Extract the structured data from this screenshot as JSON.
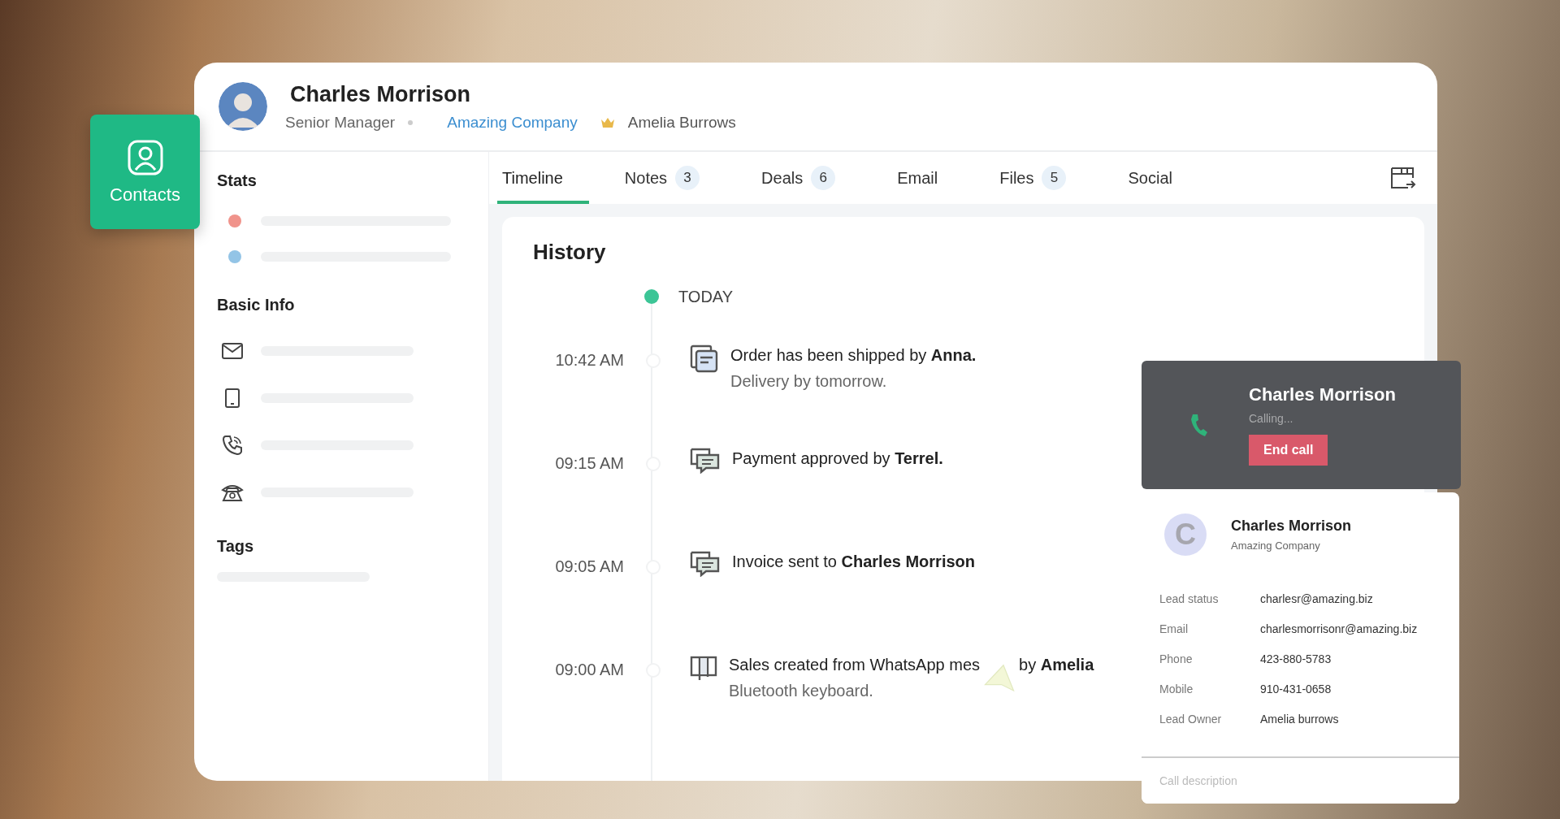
{
  "launcher": {
    "label": "Contacts"
  },
  "contact": {
    "name": "Charles Morrison",
    "title": "Senior Manager",
    "company": "Amazing Company",
    "owner": "Amelia Burrows"
  },
  "sidebar": {
    "sections": [
      {
        "kind": "stats",
        "heading": "Stats",
        "items": [
          {
            "color": "#f0938b"
          },
          {
            "color": "#93c4e6"
          }
        ]
      },
      {
        "kind": "info",
        "heading": "Basic Info"
      },
      {
        "kind": "tags",
        "heading": "Tags"
      }
    ]
  },
  "tabs": [
    {
      "label": "Timeline",
      "selected": true
    },
    {
      "label": "Notes",
      "count": "3",
      "selected": false
    },
    {
      "label": "Deals",
      "count": "6",
      "selected": false
    },
    {
      "label": "Email",
      "selected": false
    },
    {
      "label": "Files",
      "count": "5",
      "selected": false
    },
    {
      "label": "Social",
      "selected": false
    }
  ],
  "history": {
    "title": "History",
    "day": "TODAY",
    "entries": [
      {
        "kind": "note",
        "time": "10:42 AM",
        "text": "Order has been shipped by **Anna.**",
        "detail": "Delivery by tomorrow."
      },
      {
        "kind": "chat",
        "time": "09:15 AM",
        "text": "Payment approved by **Terrel.**"
      },
      {
        "kind": "chat",
        "time": "09:05 AM",
        "text": "Invoice sent to **Charles Morrison**"
      },
      {
        "kind": "board",
        "time": "09:00 AM",
        "text": "Sales created from WhatsApp mes",
        "text_continued": "by **Amelia**",
        "detail": "Bluetooth keyboard."
      }
    ]
  },
  "call": {
    "name": "Charles Morrison",
    "status": "Calling...",
    "button": "End call"
  },
  "contact_card": {
    "initial": "C",
    "name": "Charles Morrison",
    "company": "Amazing Company",
    "fields": [
      {
        "label": "Lead status",
        "value": "charlesr@amazing.biz"
      },
      {
        "label": "Email",
        "value": "charlesmorrisonr@amazing.biz"
      },
      {
        "label": "Phone",
        "value": "423-880-5783"
      },
      {
        "label": "Mobile",
        "value": "910-431-0658"
      },
      {
        "label": "Lead Owner",
        "value": "Amelia burrows"
      }
    ],
    "description_placeholder": "Call description"
  }
}
